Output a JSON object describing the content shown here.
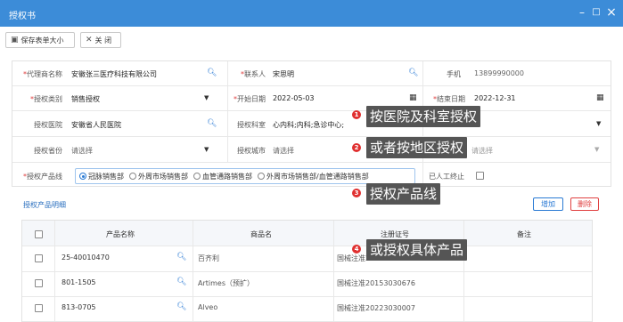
{
  "window": {
    "title": "授权书",
    "minimize": "–",
    "maximize": "□",
    "close": "×"
  },
  "toolbar": {
    "save_label": "保存表单大小",
    "close_label": "关 闭"
  },
  "form": {
    "agent": {
      "label": "代理商名称",
      "value": "安徽张三医疗科技有限公司"
    },
    "contact": {
      "label": "联系人",
      "value": "宋思明"
    },
    "phone": {
      "label": "手机",
      "value": "13899990000"
    },
    "auth_type": {
      "label": "授权类别",
      "value": "销售授权"
    },
    "start_date": {
      "label": "开始日期",
      "value": "2022-05-03"
    },
    "end_date": {
      "label": "结束日期",
      "value": "2022-12-31"
    },
    "hospital": {
      "label": "授权医院",
      "value": "安徽省人民医院"
    },
    "dept": {
      "label": "授权科室",
      "value": "心内科;内科;急诊中心;"
    },
    "province": {
      "label": "授权省份",
      "value": "请选择"
    },
    "city": {
      "label": "授权城市",
      "value": "请选择"
    },
    "district_value": "请选择",
    "product_line": {
      "label": "授权产品线",
      "options": [
        "冠脉销售部",
        "外周市场销售部",
        "血管通路销售部",
        "外周市场销售部/血管通路销售部"
      ],
      "selected": 0
    },
    "manual_stop": {
      "label": "已人工终止",
      "checked": false
    }
  },
  "products": {
    "title": "授权产品明细",
    "add_label": "增加",
    "delete_label": "删除",
    "columns": [
      "产品名称",
      "商品名",
      "注册证号",
      "备注"
    ],
    "rows": [
      {
        "name": "25-40010470",
        "trade": "百齐利",
        "reg": "国械注准20"
      },
      {
        "name": "801-1505",
        "trade": "Artimes（预扩）",
        "reg": "国械注准20153030676"
      },
      {
        "name": "813-0705",
        "trade": "Alveo",
        "reg": "国械注准20223030007"
      }
    ]
  },
  "callouts": [
    {
      "num": "1",
      "text": "按医院及科室授权"
    },
    {
      "num": "2",
      "text": "或者按地区授权"
    },
    {
      "num": "3",
      "text": "授权产品线"
    },
    {
      "num": "4",
      "text": "或授权具体产品"
    }
  ],
  "icons": {
    "search": "search-icon",
    "calendar": "calendar-icon",
    "dropdown": "chevron-down-icon",
    "save": "save-icon",
    "close": "close-icon"
  },
  "colors": {
    "titlebar": "#3c8cd8",
    "accent": "#2a7ad4",
    "delete": "#e04040",
    "callout": "#555555",
    "badge": "#e03030"
  }
}
